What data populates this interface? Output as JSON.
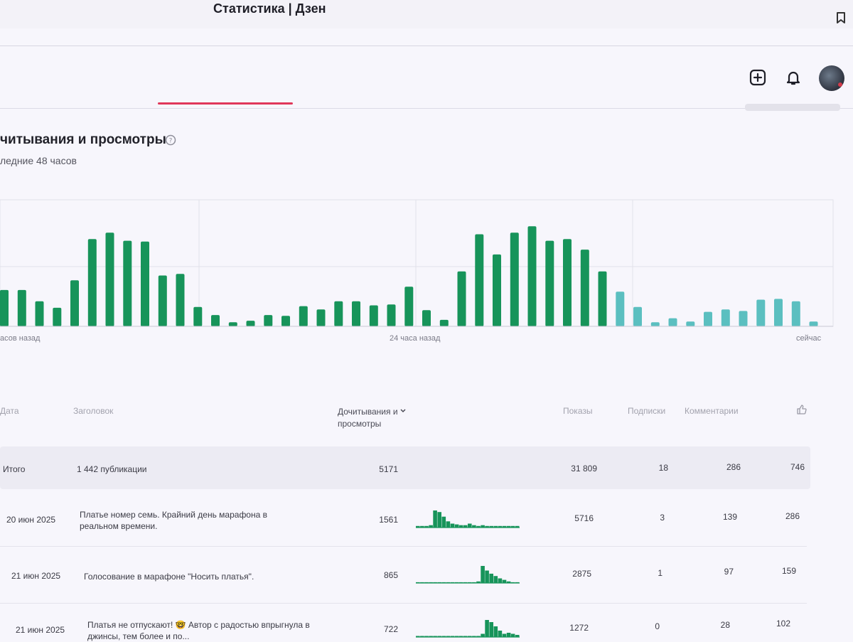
{
  "window": {
    "tab_title": "Статистика | Дзен"
  },
  "header_icons": [
    "plus-square-icon",
    "bell-icon",
    "avatar"
  ],
  "section": {
    "title": "читывания и просмотры",
    "subtitle": "ледние 48 часов"
  },
  "chart_data": {
    "type": "bar",
    "title": "",
    "x_labels": [
      "асов назад",
      "24 часа назад",
      "сейчас"
    ],
    "values": [
      45,
      45,
      31,
      23,
      57,
      108,
      116,
      106,
      105,
      63,
      65,
      24,
      14,
      5,
      7,
      14,
      13,
      25,
      21,
      31,
      31,
      26,
      27,
      49,
      20,
      8,
      68,
      114,
      89,
      116,
      124,
      106,
      108,
      95,
      68,
      43,
      24,
      5,
      10,
      6,
      18,
      21,
      19,
      33,
      34,
      31,
      6
    ],
    "colors": {
      "main": "#17945a",
      "recent": "#5bbfc0"
    },
    "recent_from_index": 35,
    "grid": true
  },
  "table": {
    "headers": {
      "date": "Дата",
      "title": "Заголовок",
      "reads": "Дочитывания и просмотры",
      "shows": "Показы",
      "subs": "Подписки",
      "comments": "Комментарии"
    },
    "total": {
      "label": "Итого",
      "publications": "1 442 публикации",
      "reads": "5171",
      "shows": "31 809",
      "subs": "18",
      "comments": "286",
      "likes": "746"
    },
    "rows": [
      {
        "date": "20 июн 2025",
        "title": "Платье номер семь. Крайний день марафона в реальном времени.",
        "reads": "1561",
        "shows": "5716",
        "subs": "3",
        "comments": "139",
        "likes": "286",
        "spark": [
          2,
          2,
          2,
          3,
          22,
          20,
          14,
          8,
          5,
          4,
          3,
          3,
          5,
          3,
          2,
          3,
          2,
          2,
          2,
          2,
          2,
          2,
          2,
          2
        ]
      },
      {
        "date": "21 июн 2025",
        "title": "Голосование в марафоне \"Носить платья\".",
        "reads": "865",
        "shows": "2875",
        "subs": "1",
        "comments": "97",
        "likes": "159",
        "spark": [
          1,
          1,
          1,
          1,
          1,
          1,
          1,
          1,
          1,
          1,
          1,
          1,
          1,
          1,
          2,
          22,
          16,
          12,
          9,
          6,
          4,
          2,
          1,
          1
        ]
      },
      {
        "date": "21 июн 2025",
        "title": "Платья не отпускают! 🤓 Автор с радостью впрыгнула в джинсы, тем более и по...",
        "reads": "722",
        "shows": "1272",
        "subs": "0",
        "comments": "28",
        "likes": "102",
        "spark": [
          1,
          1,
          1,
          1,
          1,
          1,
          1,
          1,
          1,
          1,
          1,
          1,
          1,
          1,
          1,
          3,
          16,
          14,
          10,
          6,
          3,
          4,
          3,
          2
        ]
      }
    ]
  }
}
